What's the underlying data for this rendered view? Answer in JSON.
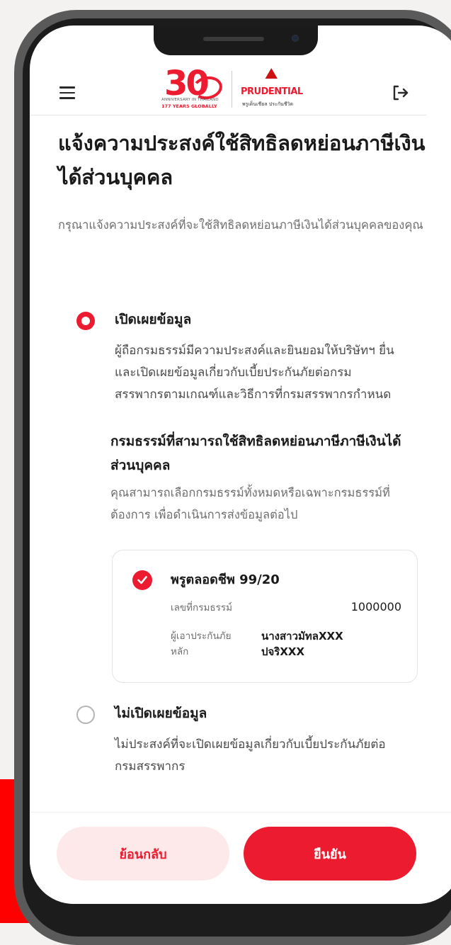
{
  "header": {
    "menu_icon": "hamburger-menu-icon",
    "logout_icon": "logout-icon",
    "logo_30": {
      "number": "30",
      "tagline1": "ANNIVERSARY IN THAILAND",
      "tagline2": "177 YEARS GLOBALLY"
    },
    "logo_prudential": {
      "name": "PRUDENTIAL",
      "subtitle": "พรูเด็นเชียล ประกันชีวิต"
    }
  },
  "page": {
    "title": "แจ้งความประสงค์ใช้สิทธิลดหย่อนภาษีเงินได้ส่วนบุคคล",
    "subtitle": "กรุณาแจ้งความประสงค์ที่จะใช้สิทธิลดหย่อนภาษีเงินได้ส่วนบุคคลของคุณ"
  },
  "options": [
    {
      "label": "เปิดเผยข้อมูล",
      "selected": true,
      "description": "ผู้ถือกรมธรรม์มีความประสงค์และยินยอมให้บริษัทฯ ยื่นและเปิดเผยข้อมูลเกี่ยวกับเบี้ยประกันภัยต่อกรมสรรพากรตามเกณฑ์และวิธีการที่กรมสรรพากรกำหนด"
    },
    {
      "label": "ไม่เปิดเผยข้อมูล",
      "selected": false,
      "description": "ไม่ประสงค์ที่จะเปิดเผยข้อมูลเกี่ยวกับเบี้ยประกันภัยต่อกรมสรรพากร"
    }
  ],
  "eligible_section": {
    "title": "กรมธรรม์ที่สามารถใช้สิทธิลดหย่อนภาษีภาษีเงินได้ส่วนบุคคล",
    "description": "คุณสามารถเลือกกรมธรรม์ทั้งหมดหรือเฉพาะกรมธรรม์ที่ต้องการ เพื่อดำเนินการส่งข้อมูลต่อไป"
  },
  "policy": {
    "checked": true,
    "name": "พรูตลอดชีพ 99/20",
    "number_label": "เลขที่กรมธรรม์",
    "number_value": "1000000",
    "insured_label": "ผู้เอาประกันภัยหลัก",
    "insured_value": "นางสาวมัทลXXX ปจริXXX"
  },
  "footer": {
    "back_label": "ย้อนกลับ",
    "confirm_label": "ยืนยัน"
  },
  "colors": {
    "brand_red": "#ed1b2f",
    "back_button_bg": "#fde9ea",
    "background_red": "#ff0000"
  }
}
